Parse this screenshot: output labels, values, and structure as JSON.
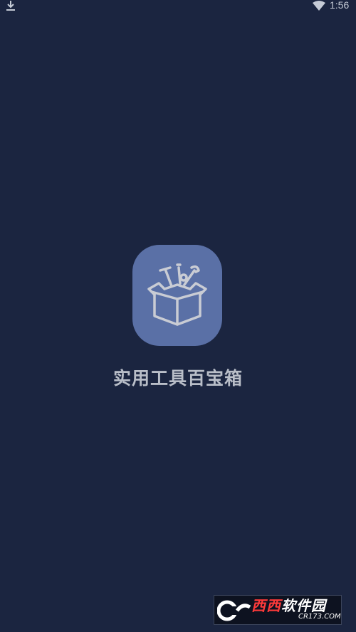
{
  "status_bar": {
    "time": "1:56",
    "left_icon": "download-icon",
    "right_icon": "wifi-icon"
  },
  "splash": {
    "icon": "toolbox-icon",
    "title": "实用工具百宝箱",
    "icon_color": "#5a70a6",
    "background_color": "#1b2540",
    "title_color": "#b9bec8"
  },
  "watermark": {
    "brand_prefix": "西西",
    "brand_suffix": "软件园",
    "domain": "CR173.COM"
  }
}
